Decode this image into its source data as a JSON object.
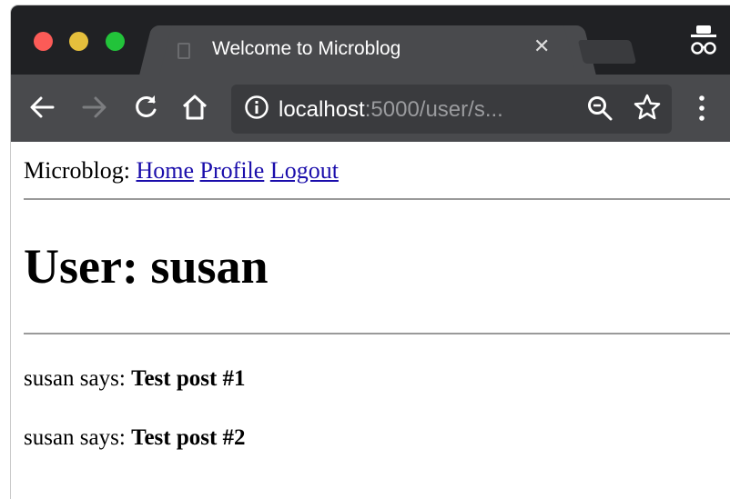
{
  "browser": {
    "tab_title": "Welcome to Microblog",
    "tab_close": "✕",
    "url_host": "localhost",
    "url_rest": ":5000/user/s..."
  },
  "page": {
    "brand": "Microblog:",
    "nav": [
      {
        "label": "Home"
      },
      {
        "label": "Profile"
      },
      {
        "label": "Logout"
      }
    ],
    "heading": "User: susan",
    "posts": [
      {
        "author_text": "susan says:",
        "body": "Test post #1"
      },
      {
        "author_text": "susan says:",
        "body": "Test post #2"
      }
    ]
  },
  "colors": {
    "tabbar": "#202124",
    "toolbar": "#494a4d",
    "link": "#1a0dab"
  }
}
